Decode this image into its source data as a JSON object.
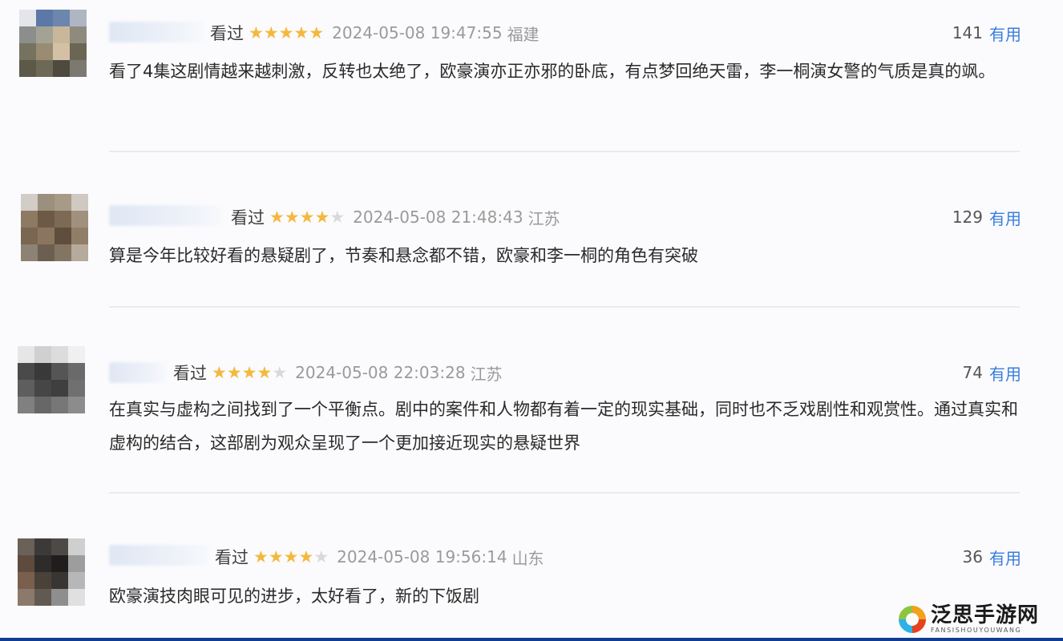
{
  "reviews": [
    {
      "watched_label": "看过",
      "rating": 5,
      "timestamp": "2024-05-08 19:47:55",
      "location": "福建",
      "useful_count": "141",
      "useful_label": "有用",
      "text": "看了4集这剧情越来越刺激，反转也太绝了，欧豪演亦正亦邪的卧底，有点梦回绝天雷，李一桐演女警的气质是真的飒。"
    },
    {
      "watched_label": "看过",
      "rating": 4,
      "timestamp": "2024-05-08 21:48:43",
      "location": "江苏",
      "useful_count": "129",
      "useful_label": "有用",
      "text": "算是今年比较好看的悬疑剧了，节奏和悬念都不错，欧豪和李一桐的角色有突破"
    },
    {
      "watched_label": "看过",
      "rating": 4,
      "timestamp": "2024-05-08 22:03:28",
      "location": "江苏",
      "useful_count": "74",
      "useful_label": "有用",
      "text": "在真实与虚构之间找到了一个平衡点。剧中的案件和人物都有着一定的现实基础，同时也不乏戏剧性和观赏性。通过真实和虚构的结合，这部剧为观众呈现了一个更加接近现实的悬疑世界"
    },
    {
      "watched_label": "看过",
      "rating": 4,
      "timestamp": "2024-05-08 19:56:14",
      "location": "山东",
      "useful_count": "36",
      "useful_label": "有用",
      "text": "欧豪演技肉眼可见的进步，太好看了，新的下饭剧"
    }
  ],
  "watermark": {
    "name": "泛思手游网",
    "subtitle": "FANSISHOUYOUWANG"
  }
}
